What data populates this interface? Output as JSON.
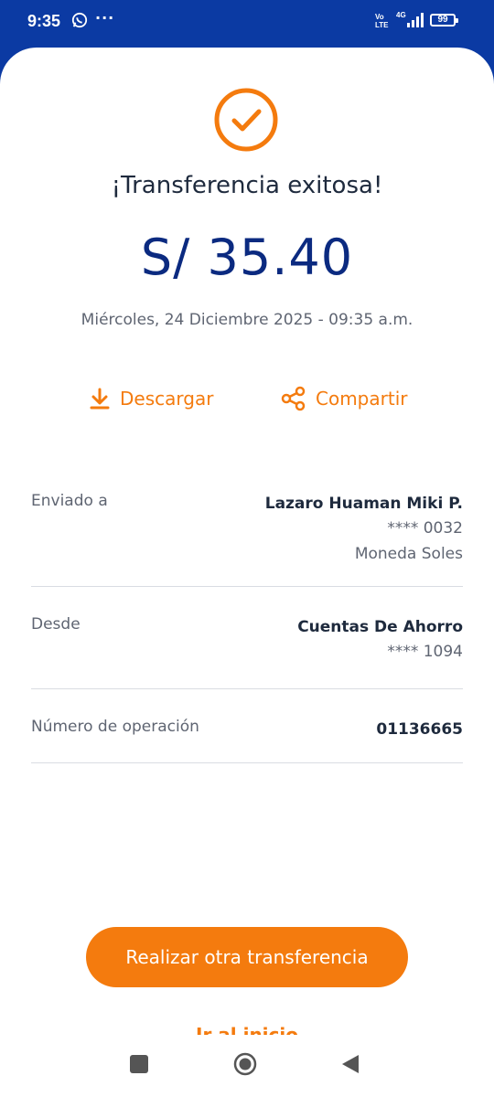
{
  "status_bar": {
    "time": "9:35",
    "dots": "···",
    "volte": "Vo\nLTE",
    "network": "4G",
    "battery": "99"
  },
  "receipt": {
    "title": "¡Transferencia exitosa!",
    "amount": "S/ 35.40",
    "datetime": "Miércoles, 24 Diciembre 2025 - 09:35 a.m."
  },
  "actions": {
    "download_label": "Descargar",
    "share_label": "Compartir"
  },
  "details": {
    "sent_to": {
      "label": "Enviado a",
      "name": "Lazaro Huaman Miki P.",
      "account": "**** 0032",
      "currency": "Moneda Soles"
    },
    "from": {
      "label": "Desde",
      "account_type": "Cuentas De Ahorro",
      "account": "**** 1094"
    },
    "operation": {
      "label": "Número de operación",
      "number": "01136665"
    }
  },
  "buttons": {
    "primary": "Realizar otra transferencia",
    "secondary": "Ir al inicio"
  },
  "colors": {
    "accent": "#f47b0e",
    "brand_blue": "#0b3aa3",
    "amount_blue": "#0b2a80"
  }
}
